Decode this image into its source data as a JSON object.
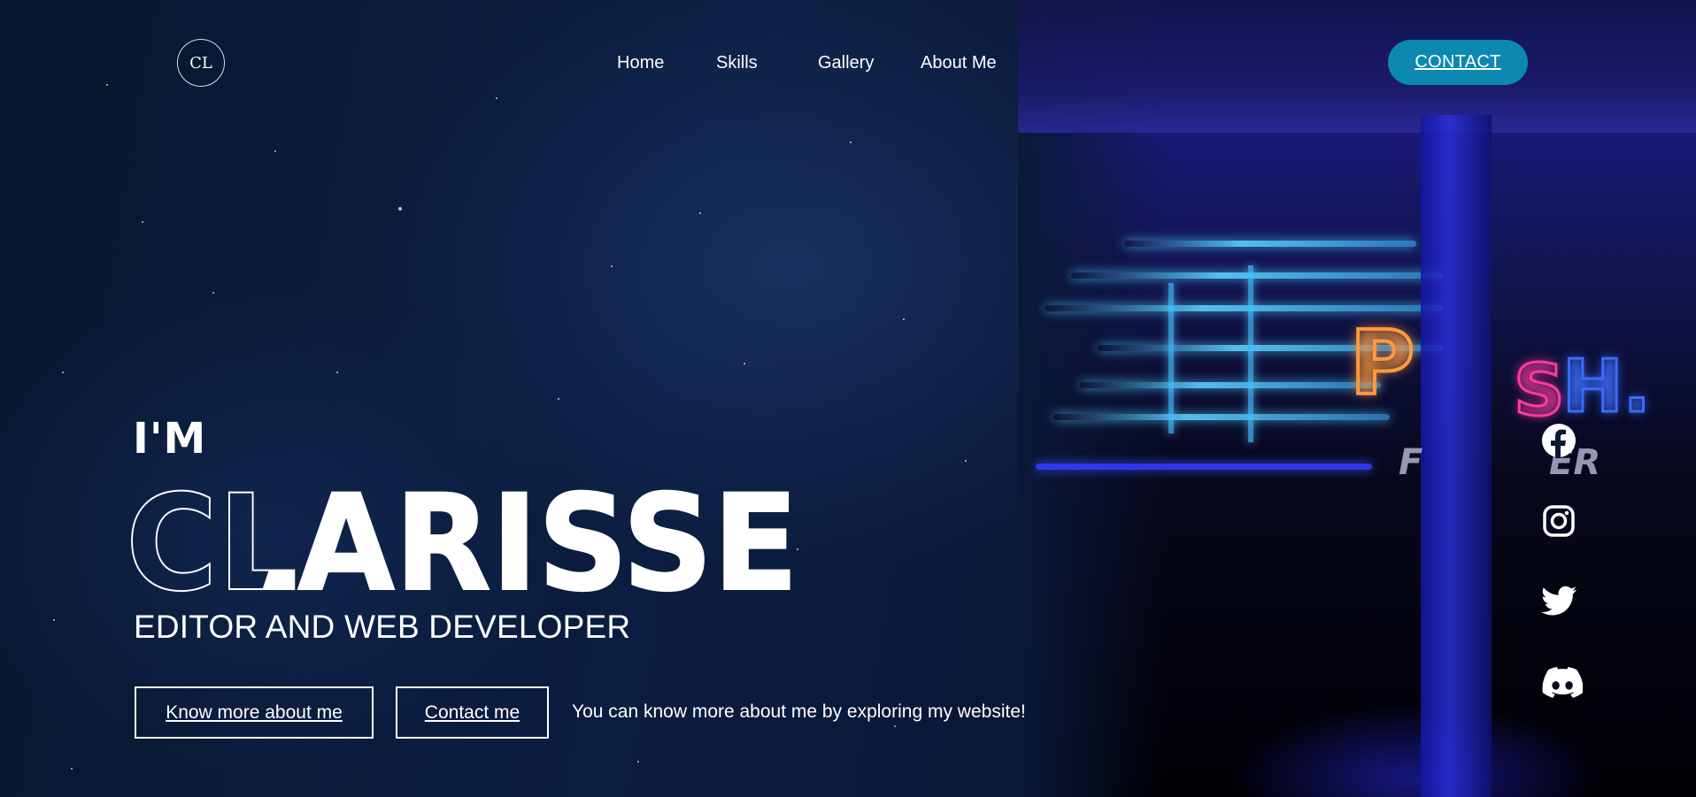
{
  "nav": {
    "logo_text": "CL",
    "menu": [
      {
        "label": "Home"
      },
      {
        "label": "Skills"
      },
      {
        "label": "Gallery"
      },
      {
        "label": "About Me"
      }
    ],
    "contact_label": "CONTACT"
  },
  "hero": {
    "intro": "I'M",
    "name": "CLARISSE",
    "subtitle": "EDITOR AND WEB DEVELOPER",
    "buttons": {
      "about": "Know more about me",
      "contact": "Contact me"
    },
    "note": "You can know more about me by exploring my website!"
  },
  "social": [
    {
      "icon": "facebook-icon"
    },
    {
      "icon": "instagram-icon"
    },
    {
      "icon": "twitter-icon"
    },
    {
      "icon": "discord-icon"
    }
  ],
  "colors": {
    "accent": "#0b89b0",
    "background": "#0a1838",
    "text": "#ffffff"
  }
}
